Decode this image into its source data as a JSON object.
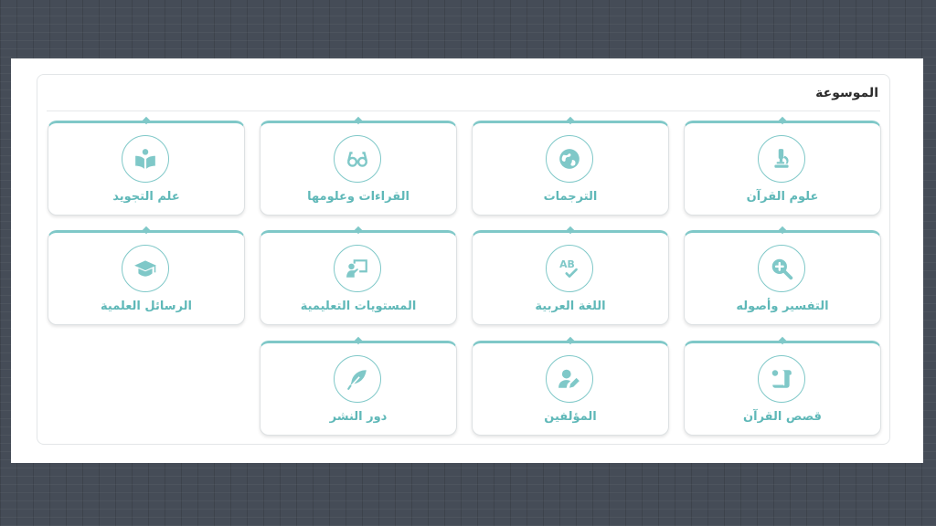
{
  "panel": {
    "title": "الموسوعة"
  },
  "accent_color": "#7fc8c8",
  "cards": [
    {
      "label": "علوم القرآن",
      "icon": "microscope-icon"
    },
    {
      "label": "الترجمات",
      "icon": "globe-icon"
    },
    {
      "label": "القراءات وعلومها",
      "icon": "glasses-icon"
    },
    {
      "label": "علم التجويد",
      "icon": "book-reader-icon"
    },
    {
      "label": "التفسير وأصوله",
      "icon": "magnifier-plus-icon"
    },
    {
      "label": "اللغة العربية",
      "icon": "ab-check-icon"
    },
    {
      "label": "المستويات التعليمية",
      "icon": "teacher-board-icon"
    },
    {
      "label": "الرسائل العلمية",
      "icon": "graduation-cap-icon"
    },
    {
      "label": "قصص القرآن",
      "icon": "scroll-icon"
    },
    {
      "label": "المؤلفين",
      "icon": "user-pen-icon"
    },
    {
      "label": "دور النشر",
      "icon": "feather-icon"
    }
  ]
}
